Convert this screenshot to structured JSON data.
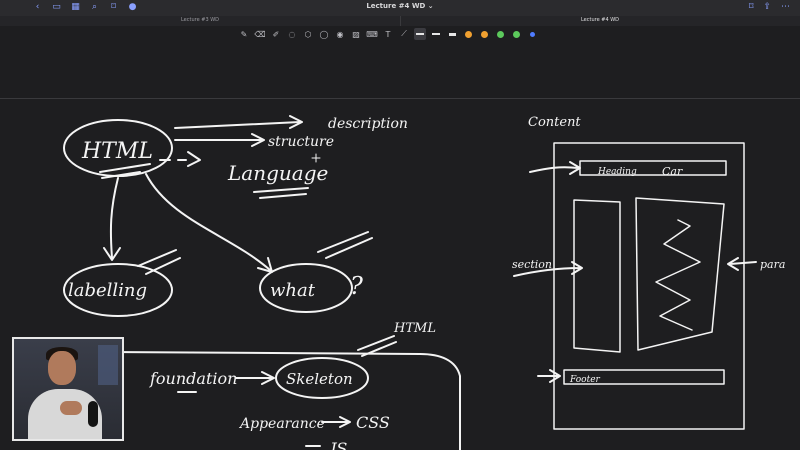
{
  "window": {
    "title": "Lecture #4 WD",
    "title_caret": "⌄"
  },
  "tabs": [
    {
      "label": "Lecture #3 WD",
      "active": false
    },
    {
      "label": "Lecture #4 WD",
      "active": true
    }
  ],
  "toolbar": {
    "tools": [
      "pencil-icon",
      "eraser-icon",
      "highlighter-icon",
      "lasso-icon",
      "shapes-icon",
      "comment-icon",
      "eye-icon",
      "image-icon",
      "keyboard-icon",
      "text-icon",
      "link-icon"
    ],
    "colors": [
      "#f0a030",
      "#f0a030",
      "#5cc95c",
      "#5cc95c"
    ],
    "accent": "#4f7cff"
  },
  "notes": {
    "html": "HTML",
    "description": "description",
    "structure": "structure",
    "language": "Language",
    "labelling": "labelling",
    "what": "what",
    "question": "?",
    "foundation": "foundation",
    "skeleton": "Skeleton",
    "html_small": "HTML",
    "appearance": "Appearance",
    "css": "CSS",
    "js": "JS",
    "content": "Content",
    "heading": "Heading",
    "car": "Car",
    "section": "section",
    "para": "para",
    "footer": "Footer"
  },
  "ink_color": "#f4f4f4"
}
